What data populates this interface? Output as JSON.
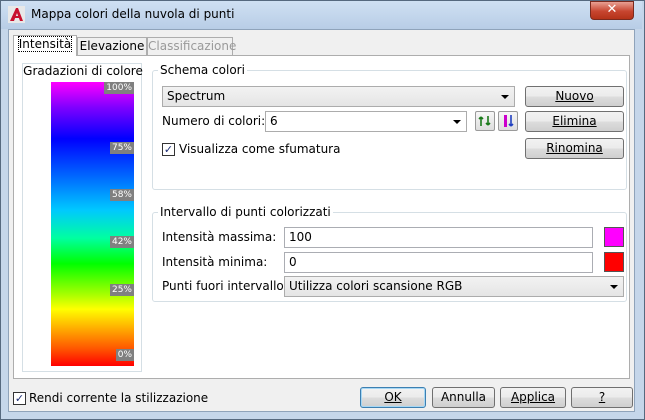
{
  "window": {
    "title": "Mappa colori della nuvola di punti",
    "close_symbol": "✕"
  },
  "tabs": [
    {
      "label": "Intensità",
      "active": true,
      "enabled": true
    },
    {
      "label": "Elevazione",
      "active": false,
      "enabled": true
    },
    {
      "label": "Classificazione",
      "active": false,
      "enabled": false
    }
  ],
  "gradient": {
    "title": "Gradazioni di colore",
    "colors": [
      "#ff00ff",
      "#0000ff",
      "#00c8ff",
      "#00ff00",
      "#ffff00",
      "#ff0000"
    ],
    "labels": [
      "100%",
      "75%",
      "58%",
      "42%",
      "25%",
      "0%"
    ]
  },
  "schema": {
    "group_title": "Schema colori",
    "scheme_value": "Spectrum",
    "count_label": "Numero di colori:",
    "count_value": "6",
    "gradient_checkbox_label": "Visualizza come sfumatura",
    "gradient_checked": true,
    "new_button": "Nuovo",
    "delete_button": "Elimina",
    "rename_button": "Rinomina",
    "swap_icon": "swap-arrows-icon",
    "invert_icon": "invert-colors-icon"
  },
  "range": {
    "group_title": "Intervallo di punti colorizzati",
    "max_label": "Intensità massima:",
    "max_value": "100",
    "max_color": "#ff00ff",
    "min_label": "Intensità minima:",
    "min_value": "0",
    "min_color": "#ff0000",
    "outside_label": "Punti fuori intervallo:",
    "outside_value": "Utilizza colori scansione RGB"
  },
  "footer": {
    "style_checkbox_label": "Rendi corrente la stilizzazione",
    "style_checked": true,
    "ok_button": "OK",
    "cancel_button": "Annulla",
    "apply_button": "Applica",
    "help_button": "?"
  }
}
